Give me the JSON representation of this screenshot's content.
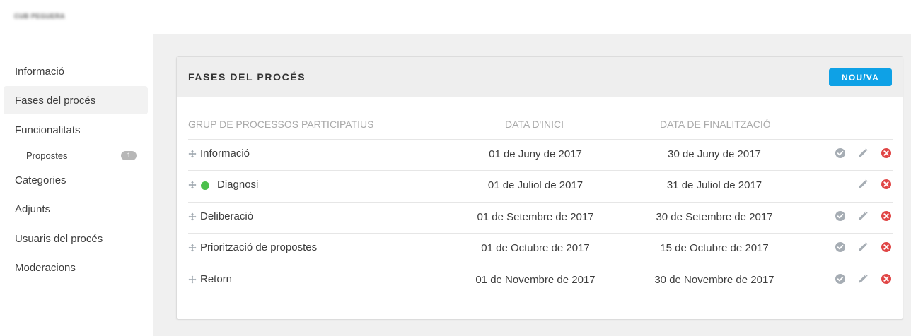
{
  "brand": "CUB PEGUERA",
  "sidebar": {
    "items": [
      {
        "label": "Informació"
      },
      {
        "label": "Fases del procés"
      },
      {
        "label": "Funcionalitats"
      },
      {
        "label": "Categories"
      },
      {
        "label": "Adjunts"
      },
      {
        "label": "Usuaris del procés"
      },
      {
        "label": "Moderacions"
      }
    ],
    "sub": {
      "label": "Propostes",
      "badge": "1"
    }
  },
  "card": {
    "title": "FASES DEL PROCÉS",
    "new_button": "NOU/VA",
    "columns": {
      "name": "GRUP DE PROCESSOS PARTICIPATIUS",
      "start": "DATA D'INICI",
      "end": "DATA DE FINALITZACIÓ"
    },
    "rows": [
      {
        "name": "Informació",
        "start": "01 de Juny de 2017",
        "end": "30 de Juny de 2017",
        "active": false
      },
      {
        "name": "Diagnosi",
        "start": "01 de Juliol de 2017",
        "end": "31 de Juliol de 2017",
        "active": true
      },
      {
        "name": "Deliberació",
        "start": "01 de Setembre de 2017",
        "end": "30 de Setembre de 2017",
        "active": false
      },
      {
        "name": "Priorització de propostes",
        "start": "01 de Octubre de 2017",
        "end": "15 de Octubre de 2017",
        "active": false
      },
      {
        "name": "Retorn",
        "start": "01 de Novembre de 2017",
        "end": "30 de Novembre de 2017",
        "active": false
      }
    ]
  },
  "colors": {
    "accent": "#0ea1e6",
    "active_dot": "#4cc04c",
    "delete": "#e04545",
    "icon_gray": "#a6adb4"
  }
}
